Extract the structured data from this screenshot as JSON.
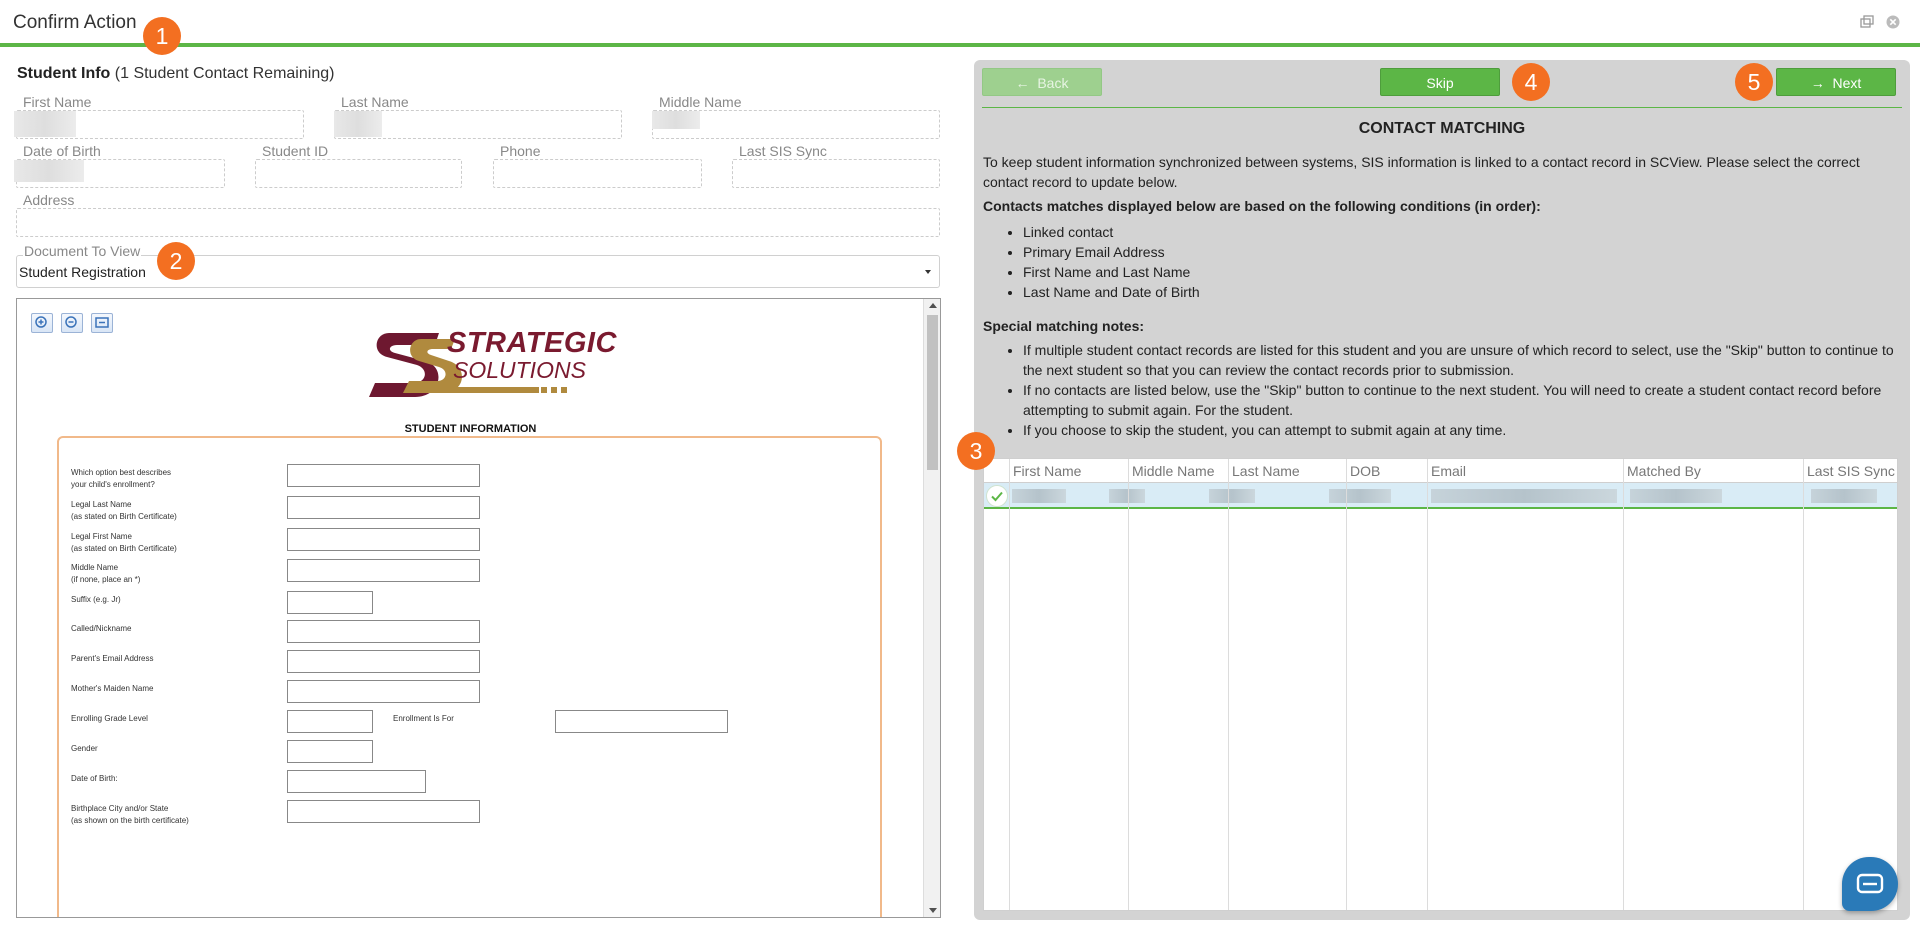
{
  "window": {
    "title": "Confirm Action"
  },
  "badges": [
    "1",
    "2",
    "3",
    "4",
    "5"
  ],
  "student_info": {
    "heading": "Student Info",
    "remaining": "(1 Student Contact Remaining)",
    "fields": {
      "first_name": "First Name",
      "last_name": "Last Name",
      "middle_name": "Middle Name",
      "dob": "Date of Birth",
      "student_id": "Student ID",
      "phone": "Phone",
      "last_sis_sync": "Last SIS Sync",
      "address": "Address"
    }
  },
  "document": {
    "label": "Document To View",
    "selected": "Student Registration"
  },
  "viewer": {
    "logo_line1": "STRATEGIC",
    "logo_line2": "SOLUTIONS",
    "form_title": "STUDENT INFORMATION",
    "rows": [
      {
        "l1": "Which option best describes",
        "l2": "your child's enrollment?"
      },
      {
        "l1": "Legal Last Name",
        "l2": "(as stated on Birth Certificate)"
      },
      {
        "l1": "Legal First Name",
        "l2": "(as stated on Birth Certificate)"
      },
      {
        "l1": "Middle Name",
        "l2": "(if none, place an *)"
      },
      {
        "l1": "Suffix (e.g. Jr)",
        "l2": ""
      },
      {
        "l1": "Called/Nickname",
        "l2": ""
      },
      {
        "l1": "Parent's Email Address",
        "l2": ""
      },
      {
        "l1": "Mother's Maiden Name",
        "l2": ""
      },
      {
        "l1": "Enrolling Grade Level",
        "l2": ""
      },
      {
        "l1": "Gender",
        "l2": ""
      },
      {
        "l1": "Date of Birth:",
        "l2": ""
      },
      {
        "l1": "Birthplace City and/or State",
        "l2": "(as shown on the birth certificate)"
      }
    ],
    "enrollment_for": "Enrollment Is For"
  },
  "nav": {
    "back": "Back",
    "skip": "Skip",
    "next": "Next"
  },
  "matching": {
    "title": "CONTACT MATCHING",
    "intro": "To keep student information synchronized between systems, SIS information is linked to a contact record in SCView. Please select the correct contact record to update below.",
    "conditions_heading": "Contacts matches displayed below are based on the following conditions (in order):",
    "conditions": [
      "Linked contact",
      "Primary Email Address",
      "First Name and Last Name",
      "Last Name and Date of Birth"
    ],
    "notes_heading": "Special matching notes:",
    "notes": [
      "If multiple student contact records are listed for this student and you are unsure of which record to select, use the \"Skip\" button to continue to the next student so that you can review the contact records prior to submission.",
      "If no contacts are listed below, use the \"Skip\" button to continue to the next student. You will need to create a student contact record before attempting to submit again. For the student.",
      "If you choose to skip the student, you can attempt to submit again at any time."
    ],
    "columns": [
      "First Name",
      "Middle Name",
      "Last Name",
      "DOB",
      "Email",
      "Matched By",
      "Last SIS Sync"
    ]
  },
  "colors": {
    "accent": "#5cb646",
    "badge": "#f36f21",
    "chat": "#2a7ab8"
  }
}
